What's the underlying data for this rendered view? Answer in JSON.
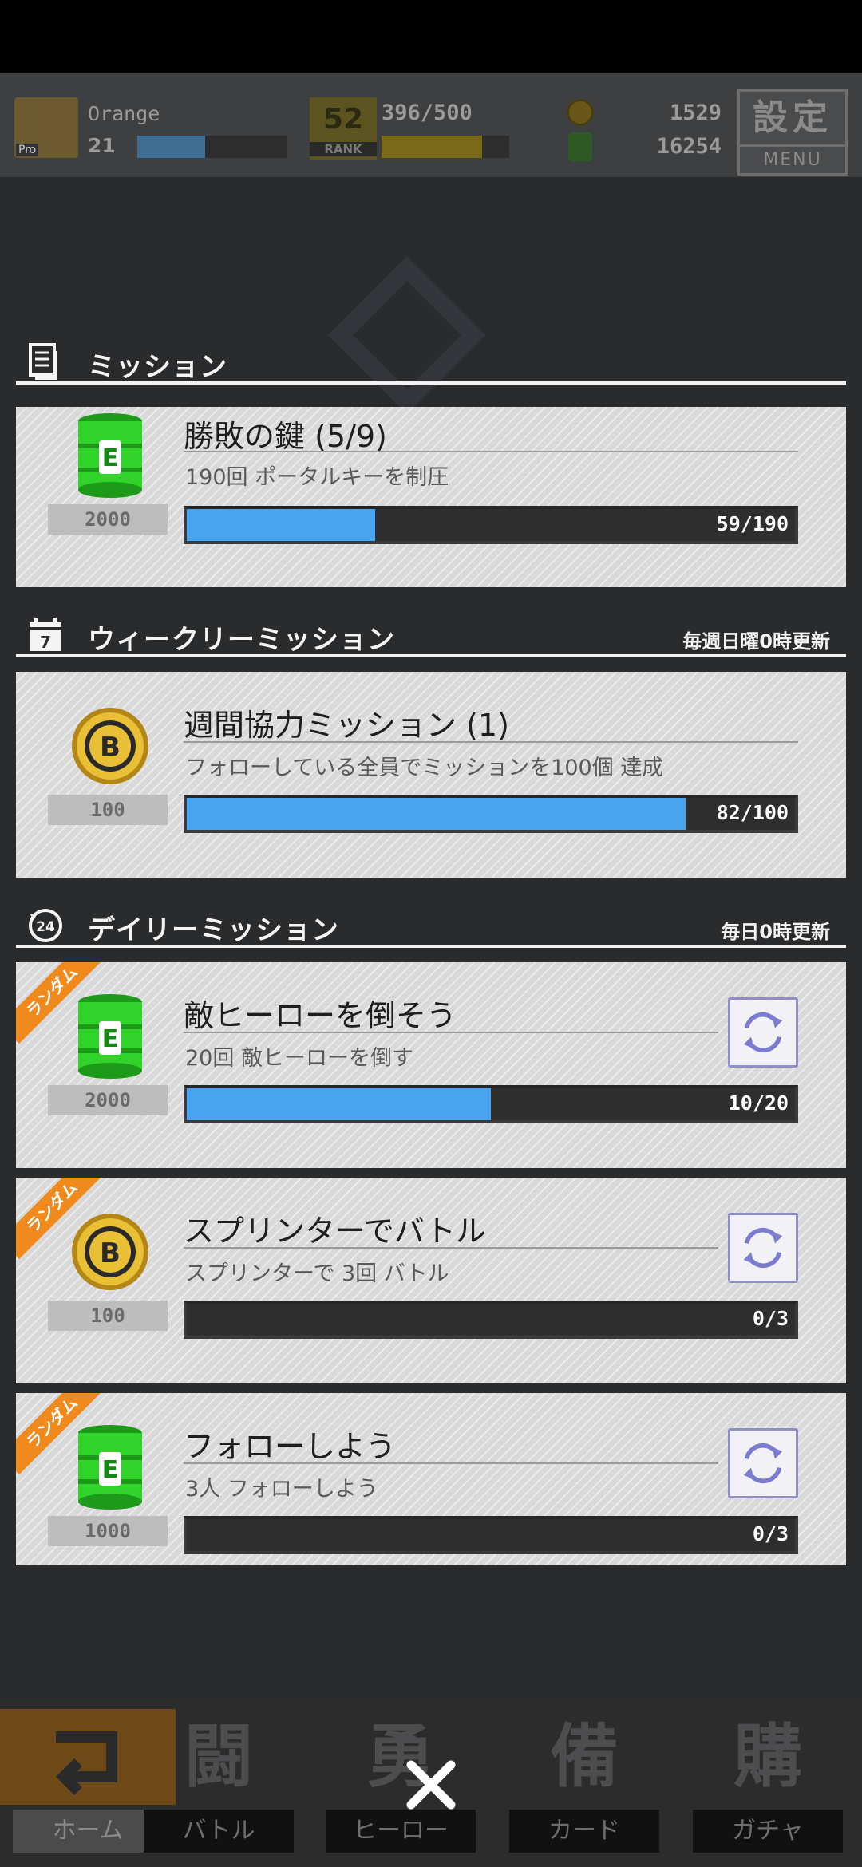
{
  "hud": {
    "player_name": "Orange",
    "level": "21",
    "rank_number": "52",
    "rank_label": "RANK",
    "rank_progress": "396/500",
    "coins": "1529",
    "energy": "16254",
    "settings_kanji": "設定",
    "settings_label": "MENU"
  },
  "sections": {
    "mission": "ミッション",
    "weekly": "ウィークリーミッション",
    "weekly_note": "毎週日曜0時更新",
    "daily": "デイリーミッション",
    "daily_note": "毎日0時更新",
    "weekly_icon_num": "7",
    "daily_icon_num": "24"
  },
  "missions": [
    {
      "title": "勝敗の鍵 (5/9)",
      "desc": "190回 ポータルキーを制圧",
      "reward": "2000",
      "reward_icon": "green-can-icon",
      "progress_text": "59/190",
      "progress": 0.31
    },
    {
      "title": "週間協力ミッション (1)",
      "desc": "フォローしている全員でミッションを100個 達成",
      "reward": "100",
      "reward_icon": "gold-coin-icon",
      "progress_text": "82/100",
      "progress": 0.82
    },
    {
      "title": "敵ヒーローを倒そう",
      "desc": "20回 敵ヒーローを倒す",
      "reward": "2000",
      "reward_icon": "green-can-icon",
      "progress_text": "10/20",
      "progress": 0.5,
      "tag": "ランダム"
    },
    {
      "title": "スプリンターでバトル",
      "desc": "スプリンターで 3回 バトル",
      "reward": "100",
      "reward_icon": "gold-coin-icon",
      "progress_text": "0/3",
      "progress": 0.0,
      "tag": "ランダム"
    },
    {
      "title": "フォローしよう",
      "desc": "3人 フォローしよう",
      "reward": "1000",
      "reward_icon": "green-can-icon",
      "progress_text": "0/3",
      "progress": 0.0,
      "tag": "ランダム"
    }
  ],
  "nav": [
    {
      "icon": "home-icon",
      "label": "ホーム"
    },
    {
      "big": "闘",
      "label": "バトル"
    },
    {
      "big": "勇",
      "label": "ヒーロー"
    },
    {
      "big": "備",
      "label": "カード"
    },
    {
      "big": "購",
      "label": "ガチャ"
    }
  ],
  "colors": {
    "progress_fill": "#48a4ef",
    "ribbon": "#f08a1c",
    "can_green": "#2fd32a",
    "coin_gold": "#e0b020"
  }
}
